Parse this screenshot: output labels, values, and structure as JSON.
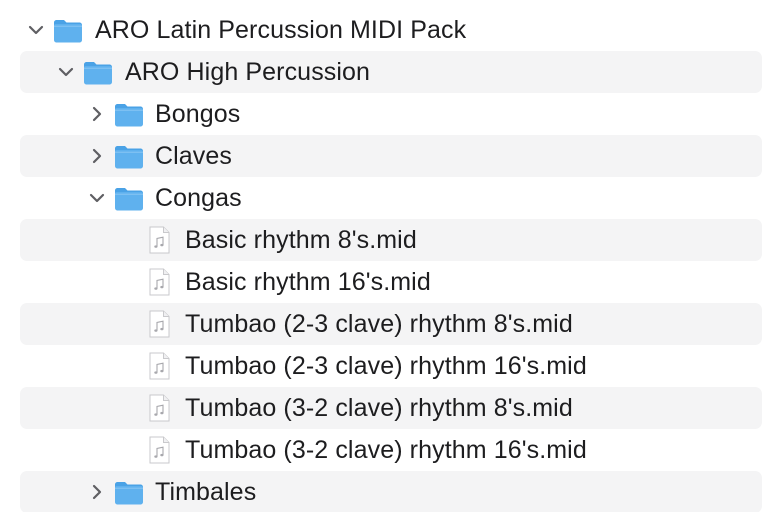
{
  "colors": {
    "folder": "#5fb1ee",
    "folder_tab": "#4aa2e6",
    "stripe": "#f4f4f5",
    "chevron": "#5f5f63",
    "file_icon_border": "#c9c9cc"
  },
  "tree": {
    "root": {
      "label": "ARO Latin Percussion MIDI Pack",
      "expanded": true,
      "icon": "folder-icon"
    },
    "high_percussion": {
      "label": "ARO High Percussion",
      "expanded": true,
      "icon": "folder-icon"
    },
    "bongos": {
      "label": "Bongos",
      "expanded": false,
      "icon": "folder-icon"
    },
    "claves": {
      "label": "Claves",
      "expanded": false,
      "icon": "folder-icon"
    },
    "congas": {
      "label": "Congas",
      "expanded": true,
      "icon": "folder-icon"
    },
    "files": [
      {
        "label": "Basic rhythm 8's.mid",
        "icon": "midi-file-icon"
      },
      {
        "label": "Basic rhythm 16's.mid",
        "icon": "midi-file-icon"
      },
      {
        "label": "Tumbao (2-3 clave) rhythm 8's.mid",
        "icon": "midi-file-icon"
      },
      {
        "label": "Tumbao (2-3 clave) rhythm 16's.mid",
        "icon": "midi-file-icon"
      },
      {
        "label": "Tumbao (3-2 clave) rhythm 8's.mid",
        "icon": "midi-file-icon"
      },
      {
        "label": "Tumbao (3-2 clave) rhythm 16's.mid",
        "icon": "midi-file-icon"
      }
    ],
    "timbales": {
      "label": "Timbales",
      "expanded": false,
      "icon": "folder-icon"
    }
  }
}
